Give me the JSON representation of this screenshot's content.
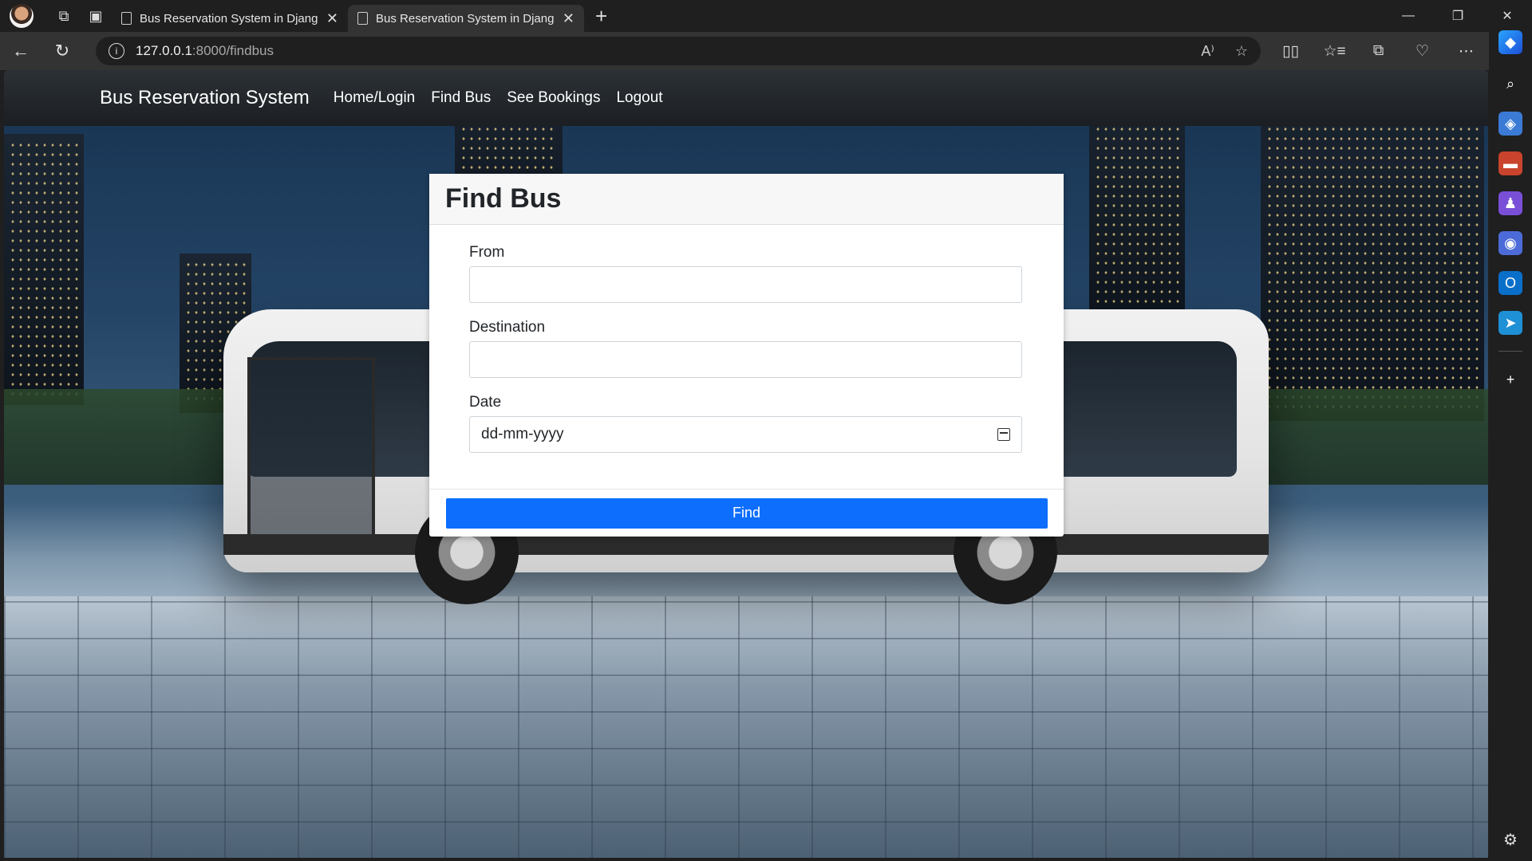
{
  "browser": {
    "tabs": [
      {
        "title": "Bus Reservation System in Djang",
        "active": false
      },
      {
        "title": "Bus Reservation System in Djang",
        "active": true
      }
    ],
    "url_host": "127.0.0.1",
    "url_path": ":8000/findbus",
    "icons": {
      "workspaces": "workspaces-icon",
      "tab_actions": "tab-actions-icon",
      "new_tab": "+",
      "minimize": "—",
      "restore": "❐",
      "close": "✕",
      "back": "←",
      "refresh": "↻",
      "read_aloud": "A⁾",
      "favorite": "☆",
      "split": "▯▯",
      "favorites": "☆≡",
      "collections": "⧉",
      "browser_essentials": "♡",
      "more": "⋯"
    }
  },
  "navbar": {
    "brand": "Bus Reservation System",
    "links": [
      "Home/Login",
      "Find Bus",
      "See Bookings",
      "Logout"
    ]
  },
  "form": {
    "title": "Find Bus",
    "from_label": "From",
    "from_value": "",
    "destination_label": "Destination",
    "destination_value": "",
    "date_label": "Date",
    "date_placeholder": "dd-mm-yyyy",
    "submit_label": "Find"
  },
  "colors": {
    "primary_button": "#0d6efd",
    "navbar": "#212529"
  }
}
